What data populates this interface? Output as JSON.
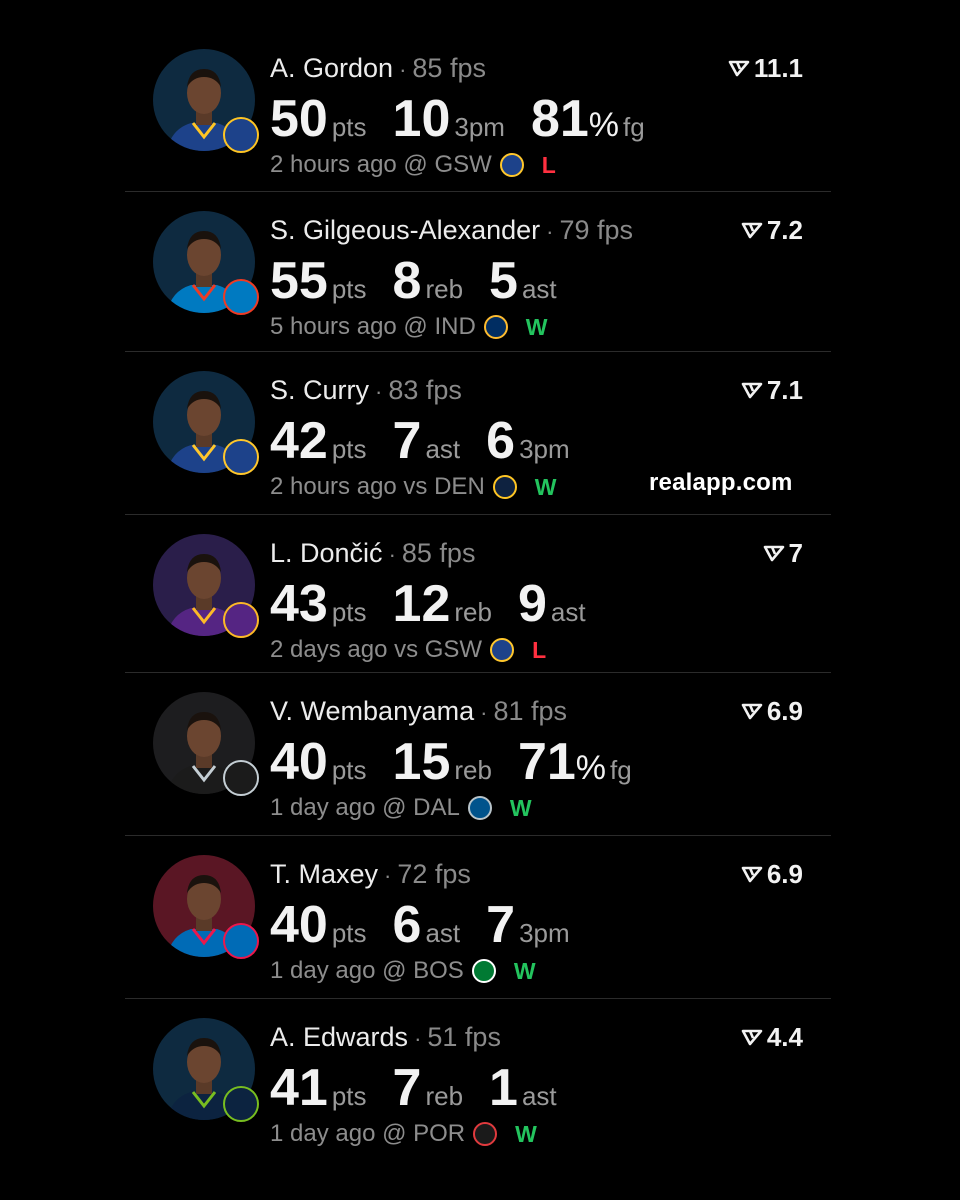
{
  "watermark": "realapp.com",
  "players": [
    {
      "name": "A. Gordon",
      "fps": "85 fps",
      "score": "11.1",
      "stats": [
        {
          "value": "50",
          "unit": "pts"
        },
        {
          "value": "10",
          "unit": "3pm"
        },
        {
          "value": "81",
          "pct": "%",
          "unit": "fg"
        }
      ],
      "time": "2 hours ago",
      "loc": "@",
      "opponent": "GSW",
      "result": "L",
      "team_color": "#1d428a",
      "team_accent": "#fec524",
      "opp_color": "#1d428a",
      "opp_accent": "#ffc72c",
      "bg": "#0e2a40"
    },
    {
      "name": "S. Gilgeous-Alexander",
      "fps": "79 fps",
      "score": "7.2",
      "stats": [
        {
          "value": "55",
          "unit": "pts"
        },
        {
          "value": "8",
          "unit": "reb"
        },
        {
          "value": "5",
          "unit": "ast"
        }
      ],
      "time": "5 hours ago",
      "loc": "@",
      "opponent": "IND",
      "result": "W",
      "team_color": "#007ac1",
      "team_accent": "#ef3b24",
      "opp_color": "#002d62",
      "opp_accent": "#fdbb30",
      "bg": "#0e2a40"
    },
    {
      "name": "S. Curry",
      "fps": "83 fps",
      "score": "7.1",
      "stats": [
        {
          "value": "42",
          "unit": "pts"
        },
        {
          "value": "7",
          "unit": "ast"
        },
        {
          "value": "6",
          "unit": "3pm"
        }
      ],
      "time": "2 hours ago",
      "loc": "vs",
      "opponent": "DEN",
      "result": "W",
      "team_color": "#1d428a",
      "team_accent": "#ffc72c",
      "opp_color": "#0e2240",
      "opp_accent": "#fec524",
      "bg": "#0e2a40"
    },
    {
      "name": "L. Dončić",
      "fps": "85 fps",
      "score": "7",
      "stats": [
        {
          "value": "43",
          "unit": "pts"
        },
        {
          "value": "12",
          "unit": "reb"
        },
        {
          "value": "9",
          "unit": "ast"
        }
      ],
      "time": "2 days ago",
      "loc": "vs",
      "opponent": "GSW",
      "result": "L",
      "team_color": "#552583",
      "team_accent": "#fdb927",
      "opp_color": "#1d428a",
      "opp_accent": "#ffc72c",
      "bg": "#2a1e4a"
    },
    {
      "name": "V. Wembanyama",
      "fps": "81 fps",
      "score": "6.9",
      "stats": [
        {
          "value": "40",
          "unit": "pts"
        },
        {
          "value": "15",
          "unit": "reb"
        },
        {
          "value": "71",
          "pct": "%",
          "unit": "fg"
        }
      ],
      "time": "1 day ago",
      "loc": "@",
      "opponent": "DAL",
      "result": "W",
      "team_color": "#1b1b1b",
      "team_accent": "#c4ced4",
      "opp_color": "#00538c",
      "opp_accent": "#b8c4ca",
      "bg": "#1d1d1f"
    },
    {
      "name": "T. Maxey",
      "fps": "72 fps",
      "score": "6.9",
      "stats": [
        {
          "value": "40",
          "unit": "pts"
        },
        {
          "value": "6",
          "unit": "ast"
        },
        {
          "value": "7",
          "unit": "3pm"
        }
      ],
      "time": "1 day ago",
      "loc": "@",
      "opponent": "BOS",
      "result": "W",
      "team_color": "#006bb6",
      "team_accent": "#ed174c",
      "opp_color": "#007a33",
      "opp_accent": "#ffffff",
      "bg": "#5a1624"
    },
    {
      "name": "A. Edwards",
      "fps": "51 fps",
      "score": "4.4",
      "stats": [
        {
          "value": "41",
          "unit": "pts"
        },
        {
          "value": "7",
          "unit": "reb"
        },
        {
          "value": "1",
          "unit": "ast"
        }
      ],
      "time": "1 day ago",
      "loc": "@",
      "opponent": "POR",
      "result": "W",
      "team_color": "#0c2340",
      "team_accent": "#78be20",
      "opp_color": "#1a1a1a",
      "opp_accent": "#e03a3e",
      "bg": "#0e2a40"
    }
  ]
}
